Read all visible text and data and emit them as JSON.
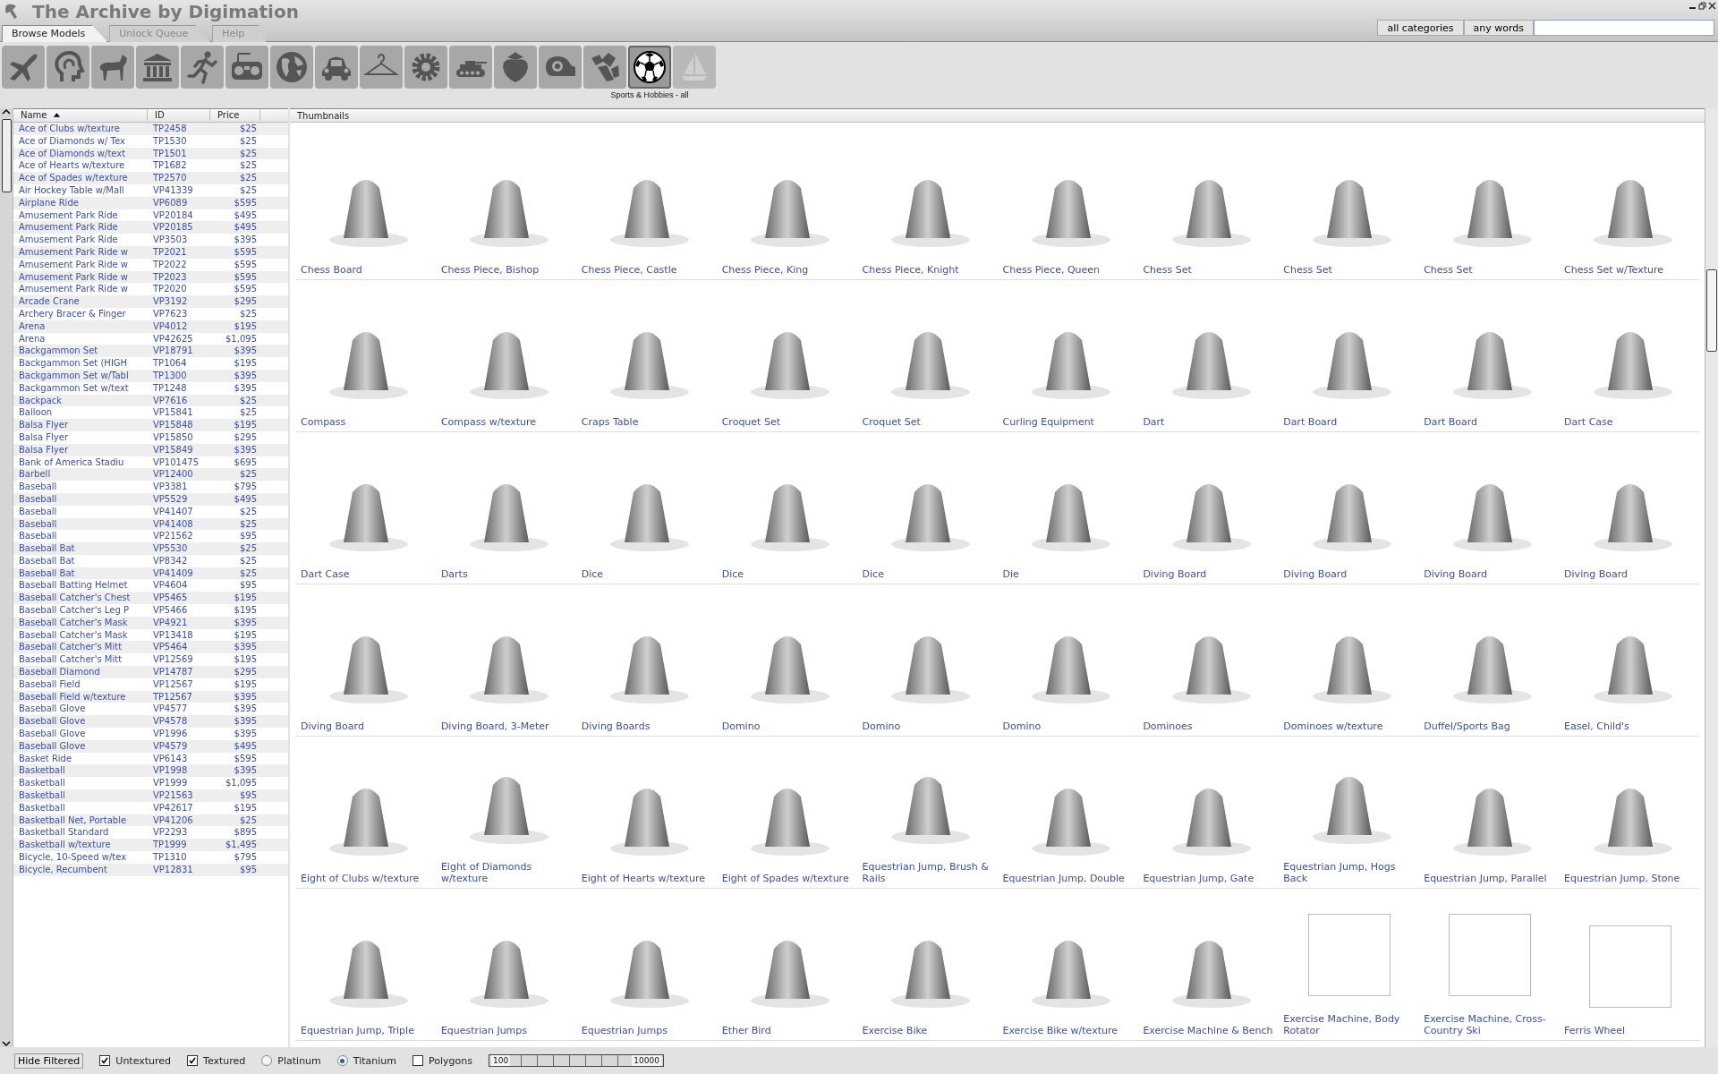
{
  "window": {
    "title": "The Archive by Digimation"
  },
  "tabs": [
    {
      "label": "Browse Models",
      "selected": true
    },
    {
      "label": "Unlock Queue",
      "selected": false
    },
    {
      "label": "Help",
      "selected": false
    }
  ],
  "search": {
    "scope": "all categories",
    "mode": "any words"
  },
  "categories": {
    "selected_label": "Sports & Hobbies - all",
    "items": [
      {
        "selected": false,
        "disabled": false
      },
      {
        "selected": false,
        "disabled": false
      },
      {
        "selected": false,
        "disabled": false
      },
      {
        "selected": false,
        "disabled": false
      },
      {
        "selected": false,
        "disabled": false
      },
      {
        "selected": false,
        "disabled": false
      },
      {
        "selected": false,
        "disabled": false
      },
      {
        "selected": false,
        "disabled": false
      },
      {
        "selected": false,
        "disabled": false
      },
      {
        "selected": false,
        "disabled": false
      },
      {
        "selected": false,
        "disabled": false
      },
      {
        "selected": false,
        "disabled": false
      },
      {
        "selected": false,
        "disabled": false
      },
      {
        "selected": false,
        "disabled": false
      },
      {
        "selected": true,
        "disabled": false
      },
      {
        "selected": false,
        "disabled": true
      }
    ]
  },
  "list": {
    "columns": [
      {
        "label": "Name",
        "sorted": true
      },
      {
        "label": "ID",
        "sorted": false
      },
      {
        "label": "Price",
        "sorted": false
      }
    ],
    "rows": [
      {
        "name": "Ace of Clubs w/texture",
        "id": "TP2458",
        "price": "$25"
      },
      {
        "name": "Ace of Diamonds w/ Tex",
        "id": "TP1530",
        "price": "$25"
      },
      {
        "name": "Ace of Diamonds w/text",
        "id": "TP1501",
        "price": "$25"
      },
      {
        "name": "Ace of Hearts w/texture",
        "id": "TP1682",
        "price": "$25"
      },
      {
        "name": "Ace of Spades w/texture",
        "id": "TP2570",
        "price": "$25"
      },
      {
        "name": "Air Hockey Table w/Mall",
        "id": "VP41339",
        "price": "$25"
      },
      {
        "name": "Airplane Ride",
        "id": "VP6089",
        "price": "$595"
      },
      {
        "name": "Amusement Park Ride",
        "id": "VP20184",
        "price": "$495"
      },
      {
        "name": "Amusement Park Ride",
        "id": "VP20185",
        "price": "$495"
      },
      {
        "name": "Amusement Park Ride",
        "id": "VP3503",
        "price": "$395"
      },
      {
        "name": "Amusement Park Ride w",
        "id": "TP2021",
        "price": "$595"
      },
      {
        "name": "Amusement Park Ride w",
        "id": "TP2022",
        "price": "$595"
      },
      {
        "name": "Amusement Park Ride w",
        "id": "TP2023",
        "price": "$595"
      },
      {
        "name": "Amusement Park Ride w",
        "id": "TP2020",
        "price": "$595"
      },
      {
        "name": "Arcade Crane",
        "id": "VP3192",
        "price": "$295"
      },
      {
        "name": "Archery Bracer & Finger",
        "id": "VP7623",
        "price": "$25"
      },
      {
        "name": "Arena",
        "id": "VP4012",
        "price": "$195"
      },
      {
        "name": "Arena",
        "id": "VP42625",
        "price": "$1,095"
      },
      {
        "name": "Backgammon Set",
        "id": "VP18791",
        "price": "$395"
      },
      {
        "name": "Backgammon Set (HIGH",
        "id": "TP1064",
        "price": "$195"
      },
      {
        "name": "Backgammon Set w/Tabl",
        "id": "TP1300",
        "price": "$395"
      },
      {
        "name": "Backgammon Set w/text",
        "id": "TP1248",
        "price": "$395"
      },
      {
        "name": "Backpack",
        "id": "VP7616",
        "price": "$25"
      },
      {
        "name": "Balloon",
        "id": "VP15841",
        "price": "$25"
      },
      {
        "name": "Balsa Flyer",
        "id": "VP15848",
        "price": "$195"
      },
      {
        "name": "Balsa Flyer",
        "id": "VP15850",
        "price": "$295"
      },
      {
        "name": "Balsa Flyer",
        "id": "VP15849",
        "price": "$395"
      },
      {
        "name": "Bank of America Stadiu",
        "id": "VP101475",
        "price": "$695"
      },
      {
        "name": "Barbell",
        "id": "VP12400",
        "price": "$25"
      },
      {
        "name": "Baseball",
        "id": "VP3381",
        "price": "$795"
      },
      {
        "name": "Baseball",
        "id": "VP5529",
        "price": "$495"
      },
      {
        "name": "Baseball",
        "id": "VP41407",
        "price": "$25"
      },
      {
        "name": "Baseball",
        "id": "VP41408",
        "price": "$25"
      },
      {
        "name": "Baseball",
        "id": "VP21562",
        "price": "$95"
      },
      {
        "name": "Baseball Bat",
        "id": "VP5530",
        "price": "$25"
      },
      {
        "name": "Baseball Bat",
        "id": "VP8342",
        "price": "$25"
      },
      {
        "name": "Baseball Bat",
        "id": "VP41409",
        "price": "$25"
      },
      {
        "name": "Baseball Batting Helmet",
        "id": "VP4604",
        "price": "$95"
      },
      {
        "name": "Baseball Catcher's Chest",
        "id": "VP5465",
        "price": "$195"
      },
      {
        "name": "Baseball Catcher's Leg P",
        "id": "VP5466",
        "price": "$195"
      },
      {
        "name": "Baseball Catcher's Mask",
        "id": "VP4921",
        "price": "$395"
      },
      {
        "name": "Baseball Catcher's Mask",
        "id": "VP13418",
        "price": "$195"
      },
      {
        "name": "Baseball Catcher's Mitt",
        "id": "VP5464",
        "price": "$395"
      },
      {
        "name": "Baseball Catcher's Mitt",
        "id": "VP12569",
        "price": "$195"
      },
      {
        "name": "Baseball Diamond",
        "id": "VP14787",
        "price": "$295"
      },
      {
        "name": "Baseball Field",
        "id": "VP12567",
        "price": "$195"
      },
      {
        "name": "Baseball Field w/texture",
        "id": "TP12567",
        "price": "$395"
      },
      {
        "name": "Baseball Glove",
        "id": "VP4577",
        "price": "$395"
      },
      {
        "name": "Baseball Glove",
        "id": "VP4578",
        "price": "$395"
      },
      {
        "name": "Baseball Glove",
        "id": "VP1996",
        "price": "$395"
      },
      {
        "name": "Baseball Glove",
        "id": "VP4579",
        "price": "$495"
      },
      {
        "name": "Basket Ride",
        "id": "VP6143",
        "price": "$595"
      },
      {
        "name": "Basketball",
        "id": "VP1998",
        "price": "$395"
      },
      {
        "name": "Basketball",
        "id": "VP1999",
        "price": "$1,095"
      },
      {
        "name": "Basketball",
        "id": "VP21563",
        "price": "$95"
      },
      {
        "name": "Basketball",
        "id": "VP42617",
        "price": "$195"
      },
      {
        "name": "Basketball Net, Portable",
        "id": "VP41206",
        "price": "$25"
      },
      {
        "name": "Basketball Standard",
        "id": "VP2293",
        "price": "$895"
      },
      {
        "name": "Basketball w/texture",
        "id": "TP1999",
        "price": "$1,495"
      },
      {
        "name": "Bicycle, 10-Speed w/tex",
        "id": "TP1310",
        "price": "$795"
      },
      {
        "name": "Bicycle, Recumbent",
        "id": "VP12831",
        "price": "$95"
      }
    ]
  },
  "thumbnails": {
    "heading": "Thumbnails",
    "items": [
      {
        "label": "Chess Board",
        "kind": "render"
      },
      {
        "label": "Chess Piece, Bishop",
        "kind": "render"
      },
      {
        "label": "Chess Piece, Castle",
        "kind": "render"
      },
      {
        "label": "Chess Piece, King",
        "kind": "render"
      },
      {
        "label": "Chess Piece, Knight",
        "kind": "render"
      },
      {
        "label": "Chess Piece, Queen",
        "kind": "render"
      },
      {
        "label": "Chess Set",
        "kind": "render"
      },
      {
        "label": "Chess Set",
        "kind": "render"
      },
      {
        "label": "Chess Set",
        "kind": "render"
      },
      {
        "label": "Chess Set w/Texture",
        "kind": "render"
      },
      {
        "label": "Compass",
        "kind": "render"
      },
      {
        "label": "Compass w/texture",
        "kind": "render"
      },
      {
        "label": "Craps Table",
        "kind": "render"
      },
      {
        "label": "Croquet Set",
        "kind": "render"
      },
      {
        "label": "Croquet Set",
        "kind": "render"
      },
      {
        "label": "Curling Equipment",
        "kind": "render"
      },
      {
        "label": "Dart",
        "kind": "render"
      },
      {
        "label": "Dart Board",
        "kind": "render"
      },
      {
        "label": "Dart Board",
        "kind": "render"
      },
      {
        "label": "Dart Case",
        "kind": "render"
      },
      {
        "label": "Dart Case",
        "kind": "render"
      },
      {
        "label": "Darts",
        "kind": "render"
      },
      {
        "label": "Dice",
        "kind": "render"
      },
      {
        "label": "Dice",
        "kind": "render"
      },
      {
        "label": "Dice",
        "kind": "render"
      },
      {
        "label": "Die",
        "kind": "render"
      },
      {
        "label": "Diving Board",
        "kind": "render"
      },
      {
        "label": "Diving Board",
        "kind": "render"
      },
      {
        "label": "Diving Board",
        "kind": "render"
      },
      {
        "label": "Diving Board",
        "kind": "render"
      },
      {
        "label": "Diving Board",
        "kind": "render"
      },
      {
        "label": "Diving Board, 3-Meter",
        "kind": "render"
      },
      {
        "label": "Diving Boards",
        "kind": "render"
      },
      {
        "label": "Domino",
        "kind": "render"
      },
      {
        "label": "Domino",
        "kind": "render"
      },
      {
        "label": "Domino",
        "kind": "render"
      },
      {
        "label": "Dominoes",
        "kind": "render"
      },
      {
        "label": "Dominoes w/texture",
        "kind": "render"
      },
      {
        "label": "Duffel/Sports Bag",
        "kind": "render"
      },
      {
        "label": "Easel, Child's",
        "kind": "render"
      },
      {
        "label": "Eight of Clubs w/texture",
        "kind": "render"
      },
      {
        "label": "Eight of Diamonds w/texture",
        "kind": "render"
      },
      {
        "label": "Eight of Hearts w/texture",
        "kind": "render"
      },
      {
        "label": "Eight of Spades w/texture",
        "kind": "render"
      },
      {
        "label": "Equestrian Jump, Brush & Rails",
        "kind": "render"
      },
      {
        "label": "Equestrian Jump, Double",
        "kind": "render"
      },
      {
        "label": "Equestrian Jump, Gate",
        "kind": "render"
      },
      {
        "label": "Equestrian Jump, Hogs Back",
        "kind": "render"
      },
      {
        "label": "Equestrian Jump, Parallel",
        "kind": "render"
      },
      {
        "label": "Equestrian Jump, Stone",
        "kind": "render"
      },
      {
        "label": "Equestrian Jump, Triple",
        "kind": "render"
      },
      {
        "label": "Equestrian Jumps",
        "kind": "render"
      },
      {
        "label": "Equestrian Jumps",
        "kind": "render"
      },
      {
        "label": "Ether Bird",
        "kind": "render"
      },
      {
        "label": "Exercise Bike",
        "kind": "render"
      },
      {
        "label": "Exercise Bike w/texture",
        "kind": "render"
      },
      {
        "label": "Exercise Machine & Bench",
        "kind": "render"
      },
      {
        "label": "Exercise Machine, Body Rotator",
        "kind": "blank"
      },
      {
        "label": "Exercise Machine, Cross-Country Ski",
        "kind": "blank"
      },
      {
        "label": "Ferris Wheel",
        "kind": "blank"
      }
    ]
  },
  "status_bar": {
    "filter_button": "Hide Filtered",
    "options": [
      {
        "kind": "checkbox",
        "label": "Untextured",
        "checked": true
      },
      {
        "kind": "checkbox",
        "label": "Textured",
        "checked": true
      },
      {
        "kind": "radio",
        "label": "Platinum",
        "checked": false
      },
      {
        "kind": "radio",
        "label": "Titanium",
        "checked": true
      },
      {
        "kind": "checkbox",
        "label": "Polygons",
        "checked": false
      }
    ],
    "polygon_range": {
      "min_label": "100",
      "max_label": "10000",
      "level": 1
    }
  }
}
